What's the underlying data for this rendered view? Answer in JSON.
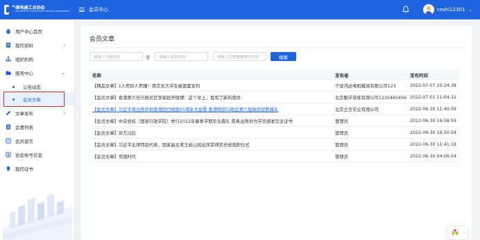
{
  "header": {
    "logo_cn": "中国电器工业协会",
    "logo_en": "China electrical equipment industry association",
    "title": "会员中心",
    "username": "ceshi12301",
    "brand_color": "#1e63e0"
  },
  "sidebar": {
    "items": [
      {
        "label": "用户中心首页",
        "icon": "home-icon"
      },
      {
        "label": "我的资料",
        "icon": "profile-icon",
        "arrow": "‹"
      },
      {
        "label": "组织机构",
        "icon": "org-icon"
      },
      {
        "label": "服务中心",
        "icon": "folder-icon",
        "arrow": "⌄"
      },
      {
        "label": "文章发布",
        "icon": "pen-icon",
        "arrow": "‹"
      },
      {
        "label": "会费列表",
        "icon": "list-icon"
      },
      {
        "label": "会员留言",
        "icon": "message-icon"
      },
      {
        "label": "协会账号信息",
        "icon": "info-icon"
      },
      {
        "label": "我的证书",
        "icon": "certificate-icon"
      }
    ],
    "sub_items": [
      {
        "label": "公告动态"
      },
      {
        "label": "会员文章"
      }
    ],
    "active_sub": "会员文章",
    "highlight_color": "#e02323"
  },
  "main": {
    "title": "会员文章",
    "filters": {
      "start_placeholder": "请输入开始时间",
      "separator": "至",
      "end_placeholder": "请输入结束时间",
      "keyword_placeholder": "请输入您想要搜索的内容",
      "search_label": "搜索"
    },
    "table": {
      "headers": {
        "name": "名称",
        "publisher": "发布者",
        "time": "发布时间"
      },
      "rows": [
        {
          "name": "【精品文章】1人死抑人死睡！南京女大学生被害案宣判",
          "publisher": "宁波鸿达电机模具有限公司123",
          "time": "2022-07-07 15:24:38"
        },
        {
          "name": "【会员文章】香港第六任行政长官李家超开微博：这个早上，我有了新的使命",
          "publisher": "北京勤学苦练有限公司1235465456",
          "time": "2022-07-01 11:04:32"
        },
        {
          "name": "【会员文章】习近平将出席庆祝香港回归祖国25周年大会暨 香港特别行政区第六届政府就职典礼",
          "publisher": "北京立言实业有限公司",
          "time": "2022-06-30 11:40:09"
        },
        {
          "name": "【会员文章】中央党校（国家行政学院）举行2022年春季学期毕业典礼 陈希出席并为学员颁发毕业证书",
          "publisher": "管理员",
          "time": "2022-06-30 16:58:59"
        },
        {
          "name": "【会员文章】对方过后",
          "publisher": "管理员",
          "time": "2022-06-30 16:50:54"
        },
        {
          "name": "【会员文章】习近平主席特别代表、国家副主席王岐山将出席菲律宾总统就职仪式",
          "publisher": "管理员",
          "time": "2022-06-30 11:41:18"
        },
        {
          "name": "【会员文章】帝国时代",
          "publisher": "管理员",
          "time": "2022-06-30 04:06:04"
        }
      ]
    }
  },
  "widget": {
    "arrow": "‹",
    "icon": "feedback-icon"
  }
}
